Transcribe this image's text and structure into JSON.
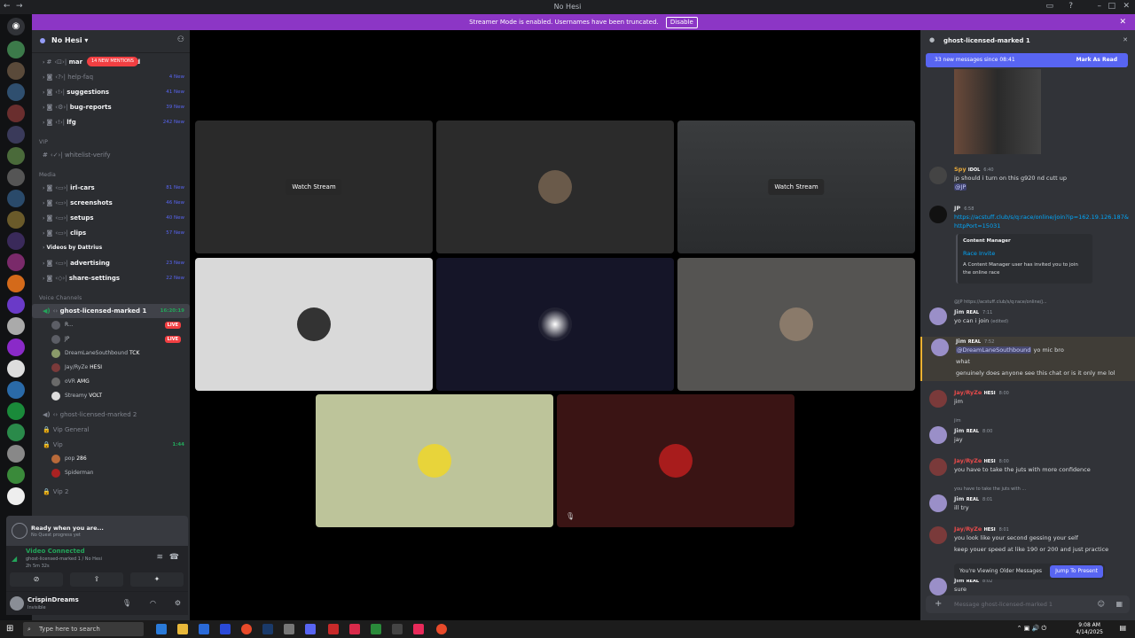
{
  "window": {
    "title": "No Hesi"
  },
  "streamer_bar": {
    "text": "Streamer Mode is enabled. Usernames have been truncated.",
    "disable": "Disable"
  },
  "server": {
    "name": "No Hesi"
  },
  "channels": {
    "top": [
      {
        "name": "mar",
        "tail": "d",
        "new": ""
      },
      {
        "name": "help-faq",
        "new": "4 New"
      },
      {
        "name": "suggestions",
        "new": "41 New"
      },
      {
        "name": "bug-reports",
        "new": "39 New"
      },
      {
        "name": "lfg",
        "new": "242 New"
      }
    ],
    "mentions_badge": "14 NEW MENTIONS",
    "vip_category": "VIP",
    "vip_channel": "whitelist-verify",
    "media_category": "Media",
    "media": [
      {
        "name": "irl-cars",
        "new": "81 New"
      },
      {
        "name": "screenshots",
        "new": "46 New"
      },
      {
        "name": "setups",
        "new": "40 New"
      },
      {
        "name": "clips",
        "new": "57 New"
      }
    ],
    "videos_label": "Videos by Dattrius",
    "more": [
      {
        "name": "advertising",
        "new": "23 New"
      },
      {
        "name": "share-settings",
        "new": "22 New"
      }
    ],
    "voice_category": "Voice Channels",
    "voice_active": {
      "name": "ghost-licensed-marked 1",
      "timer": "16:20:19"
    },
    "voice_users": [
      {
        "name": "R...",
        "live": "LIVE"
      },
      {
        "name": "JP",
        "live": "LIVE"
      },
      {
        "name": "DreamLaneSouthbound",
        "tag": "TCK"
      },
      {
        "name": "Jay/RyZe",
        "tag": "HESI"
      },
      {
        "name": "oVR",
        "tag": "AMG"
      },
      {
        "name": "Streamy",
        "tag": "VOLT"
      }
    ],
    "voice_2": "ghost-licensed-marked 2",
    "vip_general": "Vip General",
    "vip": {
      "name": "Vip",
      "timer": "1:44"
    },
    "vip_users": [
      {
        "name": "pop",
        "tag": "286"
      },
      {
        "name": "Spiderman",
        "tag": ""
      }
    ],
    "vip2": "Vip 2"
  },
  "quest": {
    "title": "Ready when you are...",
    "sub": "No Quest progress yet"
  },
  "voice_panel": {
    "status": "Video Connected",
    "channel": "ghost-licensed-marked 1 / No Hesi",
    "time": "2h 5m 32s"
  },
  "user": {
    "name": "CrispinDreams",
    "status": "Invisible"
  },
  "stage": {
    "watch": "Watch Stream"
  },
  "chat": {
    "channel": "ghost-licensed-marked 1",
    "new_bar": "33 new messages since 08:41",
    "mark_read": "Mark As Read",
    "messages": [
      {
        "name": "Spy",
        "tag": "IDOL",
        "time": "6:40",
        "text": "jp should i turn on this g920 nd cutt up",
        "sub": "@JP"
      },
      {
        "name": "JP",
        "time": "6:58",
        "text": "https://acstuff.club/s/q:race/online/join?ip=162.19.126.187&httpPort=15031"
      },
      {
        "name": "Jim",
        "tag": "REAL",
        "time": "7:11",
        "text": "yo can i join",
        "edited": "(edited)",
        "reply": "@JP https://acstuff.club/s/q:race/online/j..."
      },
      {
        "name": "Jim",
        "tag": "REAL",
        "time": "7:52",
        "mention": "@DreamLaneSouthbound",
        "text": "yo mic bro",
        "text2": "what",
        "text3": "genuinely does anyone see this chat or is it only me lol"
      },
      {
        "name": "Jay/RyZe",
        "tag": "HESI",
        "time": "8:00",
        "text": "jim"
      },
      {
        "name": "Jim",
        "tag": "REAL",
        "time": "8:00",
        "text": "jay",
        "reply": "jim"
      },
      {
        "name": "Jay/RyZe",
        "tag": "HESI",
        "time": "8:00",
        "text": "you have to take the juts with more confidence"
      },
      {
        "name": "Jim",
        "tag": "REAL",
        "time": "8:01",
        "text": "ill try",
        "reply": "you have to take the juts with ..."
      },
      {
        "name": "Jay/RyZe",
        "tag": "HESI",
        "time": "8:01",
        "text": "you look like your second gessing your self",
        "text2": "keep youer speed at like 190 or 200 and just practice"
      },
      {
        "name": "Jim",
        "tag": "REAL",
        "time": "8:02",
        "text": "sure"
      }
    ],
    "invite": {
      "author": "Content Manager",
      "title": "Race Invite",
      "body": "A Content Manager user has invited you to join the online race"
    },
    "older": "You're Viewing Older Messages",
    "jump": "Jump To Present",
    "placeholder": "Message ghost-licensed-marked 1"
  },
  "taskbar": {
    "search": "Type here to search",
    "time": "9:08 AM",
    "date": "4/14/2025"
  },
  "colors": {
    "accent": "#5865f2",
    "streamer": "#8c36c5",
    "live": "#f23f42",
    "online": "#23a55a"
  }
}
